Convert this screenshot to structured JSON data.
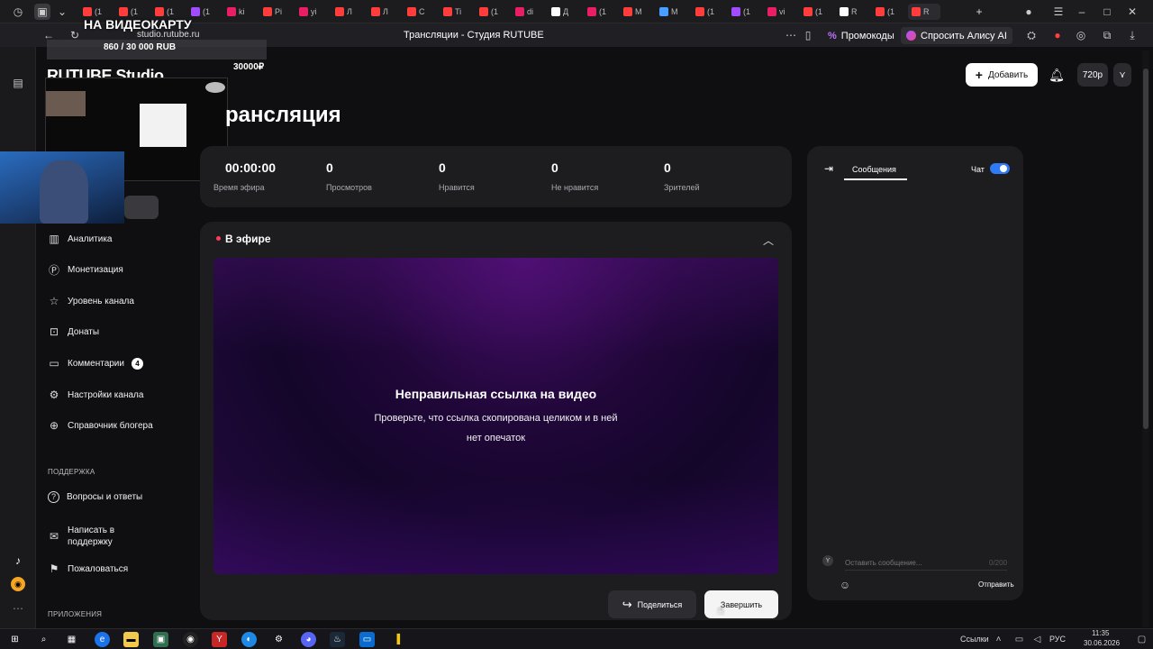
{
  "browser": {
    "tabs": [
      {
        "label": "(1",
        "color": "#ff3d3d"
      },
      {
        "label": "(1",
        "color": "#ff3d3d"
      },
      {
        "label": "(1",
        "color": "#ff3d3d"
      },
      {
        "label": "(1",
        "color": "#a24cff"
      },
      {
        "label": "ki",
        "color": "#e91e63"
      },
      {
        "label": "Pi",
        "color": "#ff3d3d"
      },
      {
        "label": "yi",
        "color": "#e91e63"
      },
      {
        "label": "Л",
        "color": "#ff3d3d"
      },
      {
        "label": "Л",
        "color": "#ff3d3d"
      },
      {
        "label": "C",
        "color": "#ff3d3d"
      },
      {
        "label": "Ti",
        "color": "#ff3d3d"
      },
      {
        "label": "(1",
        "color": "#ff3d3d"
      },
      {
        "label": "di",
        "color": "#e91e63"
      },
      {
        "label": "Д",
        "color": "#ffffff"
      },
      {
        "label": "(1",
        "color": "#e91e63"
      },
      {
        "label": "M",
        "color": "#ff3d3d"
      },
      {
        "label": "M",
        "color": "#4a9eff"
      },
      {
        "label": "(1",
        "color": "#ff3d3d"
      },
      {
        "label": "(1",
        "color": "#a24cff"
      },
      {
        "label": "vi",
        "color": "#e91e63"
      },
      {
        "label": "(1",
        "color": "#ff3d3d"
      },
      {
        "label": "R",
        "color": "#ffffff"
      },
      {
        "label": "(1",
        "color": "#ff3d3d"
      },
      {
        "label": "R",
        "color": "#ff3d3d"
      }
    ],
    "url": "studio.rutube.ru",
    "page_title": "Трансляции - Студия RUTUBE",
    "promo_label": "Промокоды",
    "alice_label": "Спросить Алису AI"
  },
  "overlay": {
    "title": "НА ВИДЕОКАРТУ",
    "goal": "860 / 30 000 RUB",
    "amount": "30000₽",
    "logo_text": "RUTUBE Studio"
  },
  "header": {
    "add_label": "Добавить",
    "quality": "720p"
  },
  "sidebar": {
    "items": [
      {
        "label": "Аналитика",
        "icon": "chart-icon"
      },
      {
        "label": "Монетизация",
        "icon": "coin-icon"
      },
      {
        "label": "Уровень канала",
        "icon": "star-icon"
      },
      {
        "label": "Донаты",
        "icon": "gift-icon"
      },
      {
        "label": "Комментарии",
        "icon": "comment-icon",
        "badge": "4"
      },
      {
        "label": "Настройки канала",
        "icon": "gear-icon"
      },
      {
        "label": "Справочник блогера",
        "icon": "book-icon"
      }
    ],
    "support_title": "ПОДДЕРЖКА",
    "support_items": [
      {
        "label": "Вопросы и ответы",
        "icon": "question-icon"
      },
      {
        "label": "Написать в поддержку",
        "icon": "mail-icon"
      },
      {
        "label": "Пожаловаться",
        "icon": "flag-icon"
      }
    ],
    "apps_title": "ПРИЛОЖЕНИЯ"
  },
  "main": {
    "title": "рансляция",
    "stats": [
      {
        "value": "00:00:00",
        "label": "Время эфира"
      },
      {
        "value": "0",
        "label": "Просмотров"
      },
      {
        "value": "0",
        "label": "Нравится"
      },
      {
        "value": "0",
        "label": "Не нравится"
      },
      {
        "value": "0",
        "label": "Зрителей"
      }
    ],
    "live_label": "В эфире",
    "error_title": "Неправильная ссылка на видео",
    "error_text_1": "Проверьте, что ссылка скопирована целиком и в ней",
    "error_text_2": "нет опечаток",
    "share_label": "Поделиться",
    "finish_label": "Завершить"
  },
  "chat": {
    "tab_label": "Сообщения",
    "toggle_label": "Чат",
    "toggle_on": true,
    "placeholder": "Оставить сообщение...",
    "counter": "0/200",
    "send_label": "Отправить"
  },
  "taskbar": {
    "links_label": "Ссылки",
    "lang": "РУС",
    "time": "11:35",
    "date": "30.06.2026"
  },
  "colors": {
    "accent_blue": "#2f7bf5",
    "live_red": "#ff3b5c",
    "purple": "#3a0c63"
  }
}
